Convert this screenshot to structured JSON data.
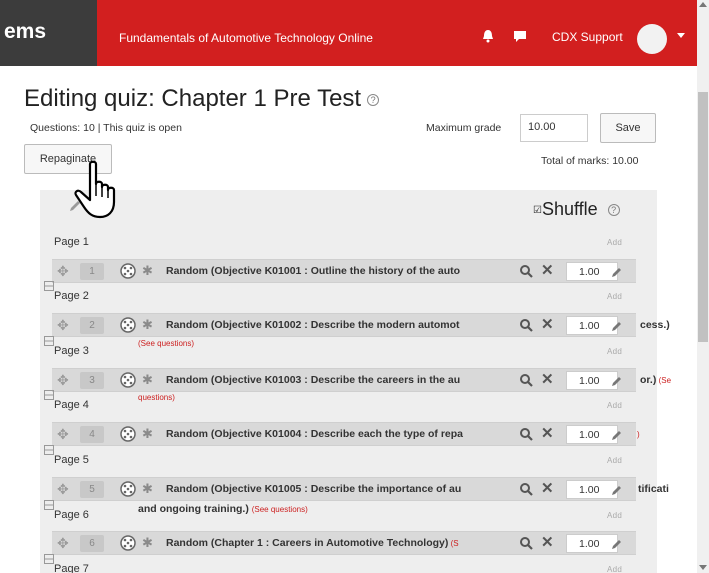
{
  "navbar": {
    "brand": "ems",
    "site_name": "Fundamentals of Automotive Technology Online",
    "user_name": "CDX Support",
    "icons": [
      "bell-icon",
      "chat-icon",
      "avatar",
      "caret-down-icon"
    ],
    "accent_color": "#d21f1f"
  },
  "header": {
    "title": "Editing quiz: Chapter 1 Pre Test",
    "status": "Questions: 10 | This quiz is open",
    "max_grade_label": "Maximum grade",
    "max_grade_value": "10.00",
    "save_label": "Save",
    "repaginate_label": "Repaginate",
    "total_marks": "Total of marks: 10.00"
  },
  "panel": {
    "shuffle_label": "Shuffle",
    "add_label": "Add",
    "see_questions": "(See questions)",
    "pages": [
      {
        "page": "Page 1",
        "number": "1",
        "text": "Random (Objective K01001 : Outline the history of the auto",
        "mark": "1.00"
      },
      {
        "page": "Page 2",
        "number": "2",
        "text": "Random (Objective K01002 : Describe the modern automot",
        "mark": "1.00",
        "overflow": "cess.)"
      },
      {
        "page": "Page 3",
        "number": "3",
        "text": "Random (Objective K01003 : Describe the careers in the au",
        "mark": "1.00",
        "overflow": "or.)",
        "overflow_red": "(Se",
        "see2": "questions)"
      },
      {
        "page": "Page 4",
        "number": "4",
        "text": "Random (Objective K01004 : Describe each the type of repa",
        "mark": "1.00",
        "overflow_red": ")"
      },
      {
        "page": "Page 5",
        "number": "5",
        "text": "Random (Objective K01005 : Describe the importance of au",
        "mark": "1.00",
        "overflow": "tificati",
        "continuation": "and ongoing training.)"
      },
      {
        "page": "Page 6",
        "number": "6",
        "text": "Random (Chapter 1 : Careers in Automotive Technology)",
        "text_red": "(S",
        "mark": "1.00"
      },
      {
        "page": "Page 7"
      }
    ]
  }
}
